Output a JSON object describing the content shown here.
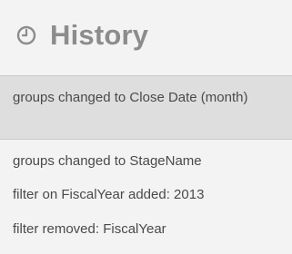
{
  "panel": {
    "icon": "clock-icon",
    "title": "History"
  },
  "history": {
    "items": [
      {
        "label": "groups changed to Close Date (month)",
        "selected": true
      },
      {
        "label": "groups changed to StageName",
        "selected": false
      },
      {
        "label": "filter on FiscalYear added: 2013",
        "selected": false
      },
      {
        "label": "filter removed: FiscalYear",
        "selected": false
      }
    ]
  },
  "colors": {
    "background": "#f3f3f3",
    "selected_background": "#dedede",
    "title": "#8c8c8c",
    "text": "#4a4a4a"
  }
}
